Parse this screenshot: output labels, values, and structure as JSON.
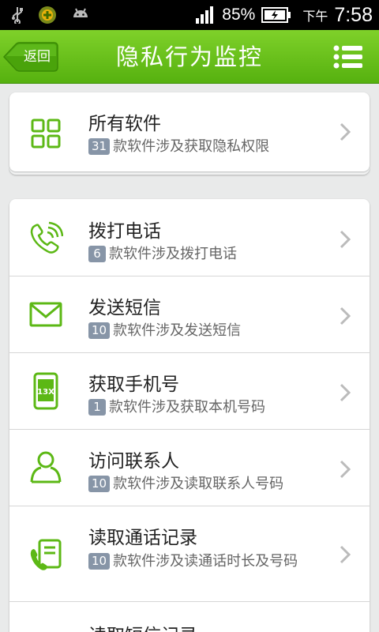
{
  "status_bar": {
    "battery_percent": "85%",
    "ampm": "下午",
    "time": "7:58"
  },
  "header": {
    "back_label": "返回",
    "title": "隐私行为监控"
  },
  "summary": {
    "title": "所有软件",
    "count": "31",
    "desc": "款软件涉及获取隐私权限"
  },
  "items": [
    {
      "icon": "phone-call-icon",
      "title": "拨打电话",
      "count": "6",
      "desc": "款软件涉及拨打电话"
    },
    {
      "icon": "envelope-icon",
      "title": "发送短信",
      "count": "10",
      "desc": "款软件涉及发送短信"
    },
    {
      "icon": "mobile-number-icon",
      "icon_text": "13X",
      "title": "获取手机号",
      "count": "1",
      "desc": "款软件涉及获取本机号码"
    },
    {
      "icon": "contacts-icon",
      "title": "访问联系人",
      "count": "10",
      "desc": "款软件涉及读取联系人号码"
    },
    {
      "icon": "call-log-icon",
      "title": "读取通话记录",
      "count": "10",
      "desc": "款软件涉及读通话时长及号码"
    },
    {
      "icon": "sms-log-icon",
      "title": "读取短信记录",
      "count": "",
      "desc": ""
    }
  ],
  "colors": {
    "accent": "#5cb815",
    "header_top": "#7fd12a",
    "header_bottom": "#56b10f",
    "badge": "#8795a7"
  }
}
